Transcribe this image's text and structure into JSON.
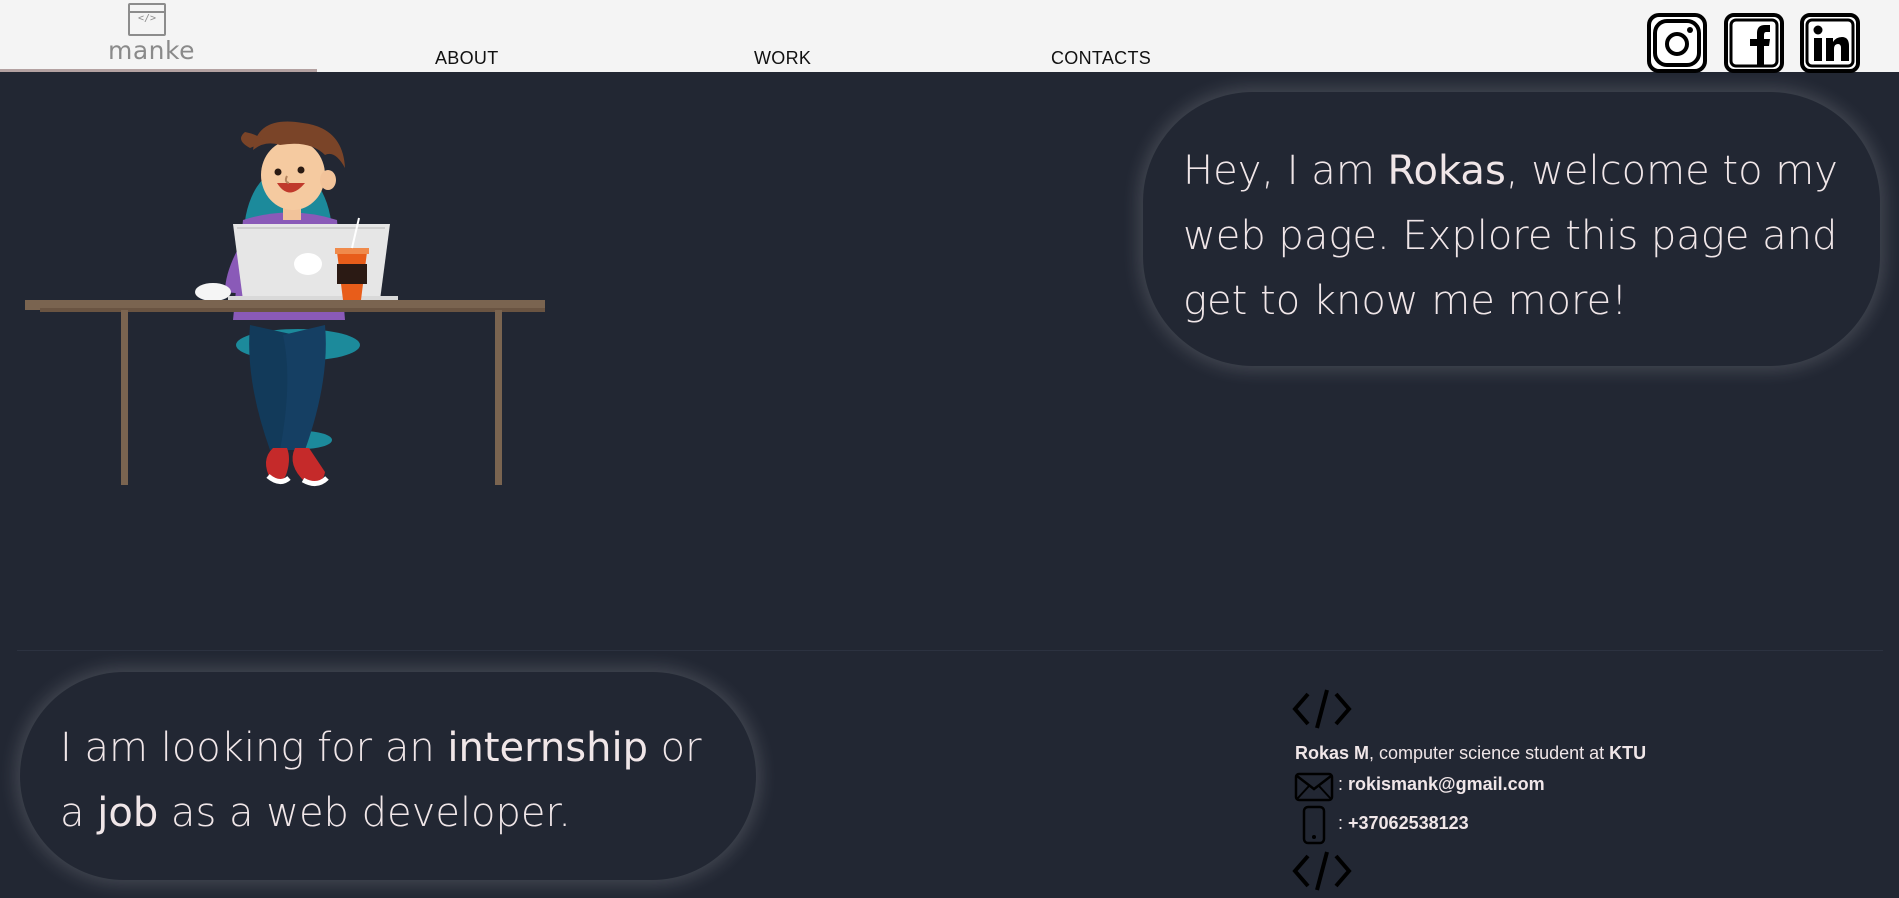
{
  "header": {
    "logo_glyph": "</>",
    "logo_text": "manke",
    "nav": [
      "ABOUT",
      "WORK",
      "CONTACTS"
    ],
    "social_icons": [
      "instagram-icon",
      "facebook-icon",
      "linkedin-icon"
    ]
  },
  "hero": {
    "welcome_pre": "Hey, I am ",
    "welcome_name": "Rokas",
    "welcome_post": ", welcome to my web page. Explore this page and get to know me more!"
  },
  "job": {
    "pre": "I am looking for an ",
    "highlight1": "internship",
    "mid": " or a ",
    "highlight2": "job",
    "post": " as a web developer."
  },
  "contact": {
    "name": "Rokas M",
    "role_text": ", computer science student at ",
    "school": "KTU",
    "separator": ": ",
    "email": "rokismank@gmail.com",
    "phone": "+37062538123"
  },
  "colors": {
    "background": "#222733",
    "header": "#f4f4f4",
    "text": "#f0e6e8",
    "logo": "#8a8a8a"
  }
}
